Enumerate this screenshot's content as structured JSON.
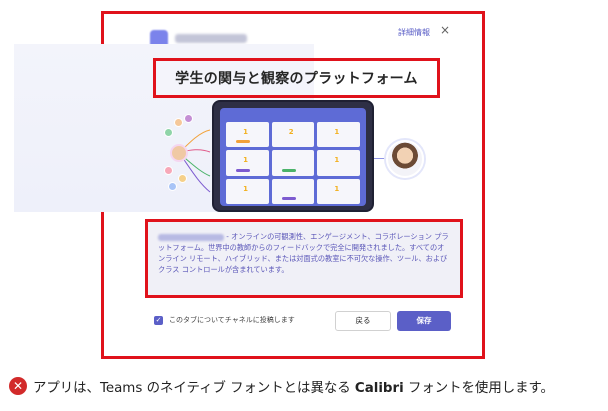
{
  "dialog": {
    "details_label": "詳細情報",
    "close_glyph": "×"
  },
  "hero": {
    "title": "学生の関与と観察のプラットフォーム",
    "card_numbers": [
      "1",
      "2",
      "1",
      "1",
      "",
      "1",
      "1",
      "",
      "1"
    ]
  },
  "description": {
    "text": " - オンラインの可観測性、エンゲージメント、コラボレーション プラットフォーム。世界中の教師からのフィードバックで完全に開発されました。すべてのオンライン リモート、ハイブリッド、または対面式の教室に不可欠な操作、ツール、およびクラス コントロールが含まれています。"
  },
  "footer": {
    "checkbox_label": "このタブについてチャネルに投稿します",
    "checkbox_checked": true,
    "back_label": "戻る",
    "save_label": "保存"
  },
  "caption": {
    "icon": "error-x-icon",
    "text_before": "アプリは、Teams のネイティブ フォントとは異なる ",
    "text_bold": "Calibri",
    "text_after": " フォントを使用します。"
  },
  "colors": {
    "highlight_border": "#e0121b",
    "accent": "#5b5fc7",
    "error_icon": "#d22a2a"
  }
}
